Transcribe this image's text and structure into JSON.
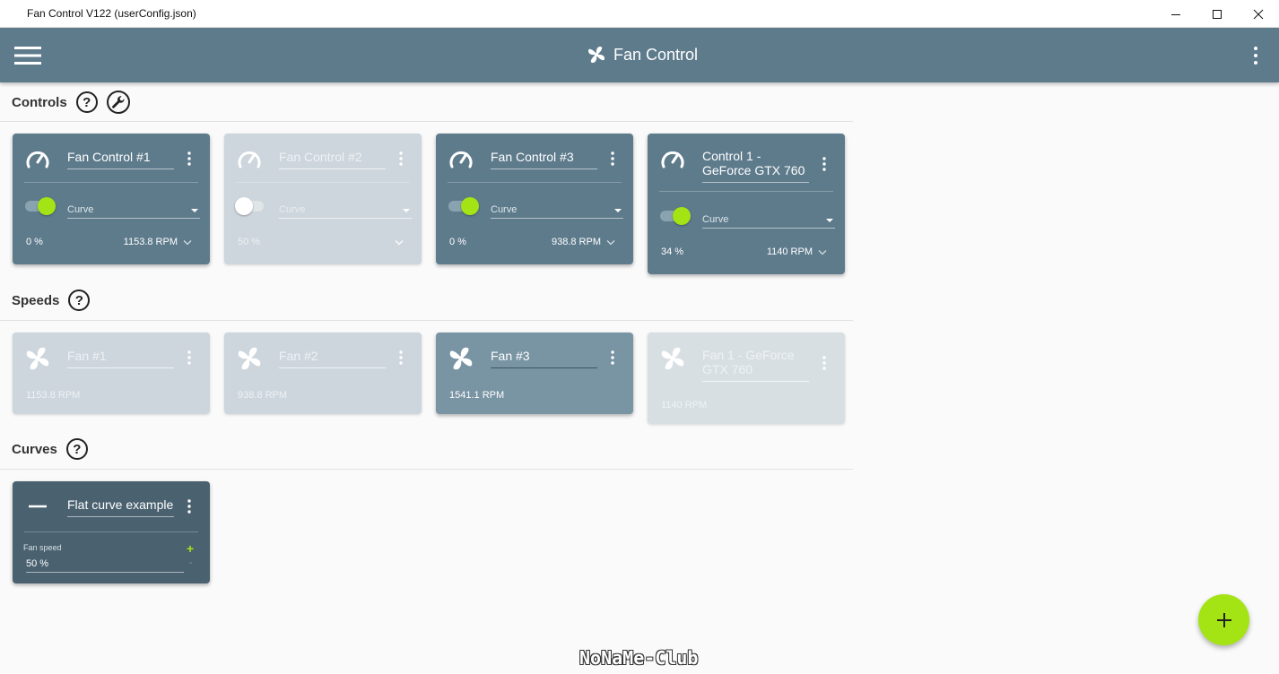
{
  "window": {
    "title": "Fan Control V122 (userConfig.json)"
  },
  "appbar": {
    "title": "Fan Control"
  },
  "sections": {
    "controls": "Controls",
    "speeds": "Speeds",
    "curves": "Curves",
    "help_glyph": "?"
  },
  "controls": [
    {
      "name": "Fan Control #1",
      "enabled": true,
      "mode": "Curve",
      "percent": "0 %",
      "rpm": "1153.8 RPM"
    },
    {
      "name": "Fan Control #2",
      "enabled": false,
      "mode": "Curve",
      "percent": "50 %",
      "rpm": ""
    },
    {
      "name": "Fan Control #3",
      "enabled": true,
      "mode": "Curve",
      "percent": "0 %",
      "rpm": "938.8 RPM"
    },
    {
      "name": "Control 1 - GeForce GTX 760",
      "enabled": true,
      "mode": "Curve",
      "percent": "34 %",
      "rpm": "1140 RPM"
    }
  ],
  "speeds": [
    {
      "name": "Fan #1",
      "enabled": false,
      "rpm": "1153.8 RPM"
    },
    {
      "name": "Fan #2",
      "enabled": false,
      "rpm": "938.8 RPM"
    },
    {
      "name": "Fan #3",
      "enabled": true,
      "rpm": "1541.1 RPM"
    },
    {
      "name": "Fan 1 - GeForce GTX 760",
      "enabled": false,
      "rpm": "1140 RPM"
    }
  ],
  "curves": [
    {
      "name": "Flat curve example",
      "field_label": "Fan speed",
      "value": "50 %",
      "plus": "+",
      "minus": "-"
    }
  ],
  "watermark": "NoNaMe-Club",
  "colors": {
    "appbar": "#5e7b8c",
    "card": "#5e7b8c",
    "card_disabled": "#cdd6dc",
    "curve_card": "#4a6170",
    "accent": "#a4e414"
  },
  "icons": {
    "menu": "hamburger-icon",
    "app": "fan-icon",
    "control": "speedometer-icon",
    "speed": "fan-icon",
    "curve": "flat-line-icon",
    "fab": "plus-icon"
  }
}
